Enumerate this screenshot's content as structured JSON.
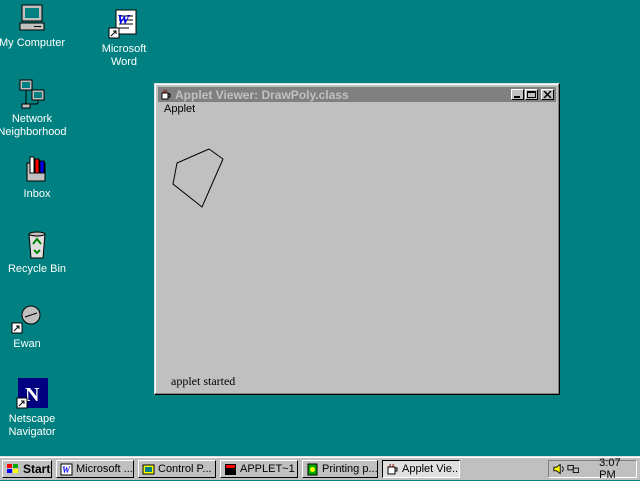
{
  "desktop": {
    "icons": [
      {
        "label": "My Computer"
      },
      {
        "label": "Microsoft\nWord"
      },
      {
        "label": "Network\nNeighborhood"
      },
      {
        "label": "Inbox"
      },
      {
        "label": "Recycle Bin"
      },
      {
        "label": "Ewan"
      },
      {
        "label": "Netscape\nNavigator"
      }
    ]
  },
  "window": {
    "title": "Applet Viewer: DrawPoly.class",
    "menu_label": "Applet",
    "status_text": "applet started",
    "polygon_points": [
      [
        50,
        33
      ],
      [
        64,
        43
      ],
      [
        43,
        91
      ],
      [
        14,
        68
      ],
      [
        18,
        47
      ],
      [
        50,
        33
      ]
    ]
  },
  "taskbar": {
    "start_label": "Start",
    "tasks": [
      {
        "label": "Microsoft ..."
      },
      {
        "label": "Control P..."
      },
      {
        "label": "APPLET~1"
      },
      {
        "label": "Printing p..."
      },
      {
        "label": "Applet Vie..."
      }
    ],
    "clock": "3:07 PM"
  },
  "colors": {
    "desktop": "#008080",
    "face": "#c0c0c0",
    "inactive_title": "#808080"
  }
}
